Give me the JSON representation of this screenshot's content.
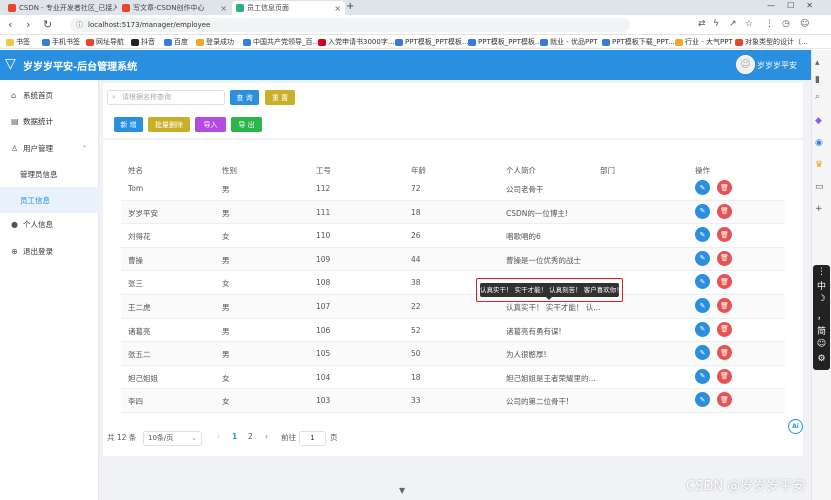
{
  "browser": {
    "tabs": [
      {
        "title": "CSDN - 专业开发者社区_已接入Dee",
        "color": "#e8452c",
        "active": false
      },
      {
        "title": "写文章-CSDN创作中心",
        "color": "#e8452c",
        "active": false
      },
      {
        "title": "员工信息页面",
        "color": "#2ab27b",
        "active": true
      }
    ],
    "url": "localhost:5173/manager/employee",
    "bookmarks": [
      {
        "label": "书签",
        "color": "#f5c342"
      },
      {
        "label": "手机书签",
        "color": "#3a7bd5"
      },
      {
        "label": "网址导航",
        "color": "#e8452c"
      },
      {
        "label": "抖音",
        "color": "#222"
      },
      {
        "label": "百度",
        "color": "#3a7bd5"
      },
      {
        "label": "登录成功",
        "color": "#f5a623"
      },
      {
        "label": "中国共产党领导_百...",
        "color": "#3a7bd5"
      },
      {
        "label": "入党申请书3000字...",
        "color": "#d0021b"
      },
      {
        "label": "PPT模板_PPT模板...",
        "color": "#3a7bd5"
      },
      {
        "label": "PPT模板_PPT模板...",
        "color": "#3a7bd5"
      },
      {
        "label": "就业 - 优品PPT",
        "color": "#3a7bd5"
      },
      {
        "label": "PPT模板下载_PPT...",
        "color": "#3a7bd5"
      },
      {
        "label": "行业 - 大气PPT",
        "color": "#f5a623"
      },
      {
        "label": "对象类型的设计（...",
        "color": "#e8452c"
      }
    ]
  },
  "header": {
    "title": "岁岁岁平安-后台管理系统",
    "user": "岁岁岁平安"
  },
  "sidebar": {
    "items": [
      {
        "label": "系统首页",
        "icon": "home-icon",
        "glyph": "⌂"
      },
      {
        "label": "数据统计",
        "icon": "chart-icon",
        "glyph": "▤"
      },
      {
        "label": "用户管理",
        "icon": "user-icon",
        "glyph": "♙"
      },
      {
        "label": "管理员信息",
        "icon": "",
        "glyph": ""
      },
      {
        "label": "员工信息",
        "icon": "",
        "glyph": ""
      },
      {
        "label": "个人信息",
        "icon": "person-icon",
        "glyph": "●"
      },
      {
        "label": "退出登录",
        "icon": "logout-icon",
        "glyph": "⊕"
      }
    ]
  },
  "search": {
    "placeholder": "请根据名称查询",
    "query_label": "查 询",
    "reset_label": "重 置"
  },
  "toolbar": {
    "add": "新 增",
    "batch_delete": "批量删除",
    "import": "导入",
    "export": "导 出"
  },
  "table": {
    "headers": [
      "姓名",
      "性别",
      "工号",
      "年龄",
      "个人简介",
      "部门",
      "操作"
    ],
    "rows": [
      [
        "Tom",
        "男",
        "112",
        "72",
        "公司老骨干"
      ],
      [
        "岁岁平安",
        "男",
        "111",
        "18",
        "CSDN的一位博主!"
      ],
      [
        "刘得花",
        "女",
        "110",
        "26",
        "唱歌唱的6"
      ],
      [
        "曹操",
        "男",
        "109",
        "44",
        "曹操是一位优秀的战士"
      ],
      [
        "张三",
        "女",
        "108",
        "38",
        ""
      ],
      [
        "王二虎",
        "男",
        "107",
        "22",
        "认真实干！ 实干才能！ 认..."
      ],
      [
        "诸葛亮",
        "男",
        "106",
        "52",
        "诸葛亮有勇有谋!"
      ],
      [
        "张五二",
        "男",
        "105",
        "50",
        "为人很憨厚!"
      ],
      [
        "妲己姐姐",
        "女",
        "104",
        "18",
        "妲己姐姐是王者荣耀里的..."
      ],
      [
        "李四",
        "女",
        "103",
        "33",
        "公司的第二位骨干!"
      ]
    ]
  },
  "tooltip": "认真实干！ 实干才能！ 认真刻苦！ 客户喜欢你！",
  "pagination": {
    "total": "共 12 条",
    "page_size": "10条/页",
    "prev": "‹",
    "pages": [
      "1",
      "2"
    ],
    "next": "›",
    "goto": "前往",
    "goto_value": "1",
    "page_unit": "页"
  },
  "ime": {
    "items": [
      "中",
      "☽",
      "，",
      "简",
      "☺",
      "⚙"
    ]
  },
  "ai_badge": "Ai",
  "watermark": "CSDN @岁岁岁平安"
}
